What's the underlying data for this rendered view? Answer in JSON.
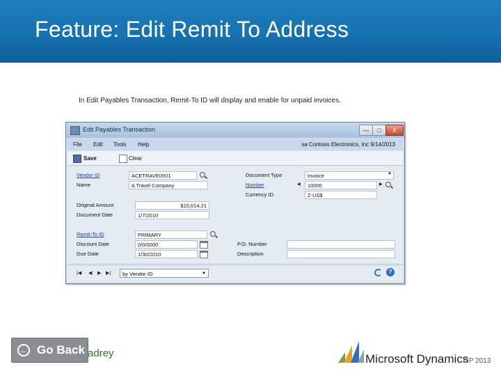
{
  "slide": {
    "title": "Feature: Edit Remit To Address",
    "caption": "In Edit Payables Transaction, Remit-To ID will display and enable for unpaid invoices."
  },
  "window": {
    "title": "Edit Payables Transaction",
    "buttons": {
      "minimize": "—",
      "maximize": "□",
      "close": "X"
    },
    "menu": [
      "File",
      "Edit",
      "Tools",
      "Help"
    ],
    "company": "sa  Contoso Electronics, Inc  9/14/2013",
    "toolbar": {
      "save": "Save",
      "clear": "Clear"
    },
    "fields": {
      "vendor_id": {
        "label": "Vendor ID",
        "value": "ACETRAVE0001"
      },
      "name": {
        "label": "Name",
        "value": "A Travel Company"
      },
      "original_amount": {
        "label": "Original Amount",
        "value": "$15,014.21"
      },
      "document_date": {
        "label": "Document Date",
        "value": "1/7/2010"
      },
      "remit_to_id": {
        "label": "Remit-To ID",
        "value": "PRIMARY"
      },
      "discount_date": {
        "label": "Discount Date",
        "value": "0/0/0000"
      },
      "due_date": {
        "label": "Due Date",
        "value": "1/30/2010"
      },
      "document_type": {
        "label": "Document Type",
        "value": "Invoice"
      },
      "number": {
        "label": "Number",
        "value": "10000"
      },
      "currency_id": {
        "label": "Currency ID",
        "value": "Z-US$"
      },
      "po_number": {
        "label": "P.O. Number",
        "value": ""
      },
      "description": {
        "label": "Description",
        "value": ""
      }
    },
    "navbar": {
      "sort_by": "by Vendor ID",
      "help": "?"
    }
  },
  "footer": {
    "go_back": "Go Back",
    "brand": "adrey",
    "ms_text": "Microsoft Dynamics",
    "gp": "GP 2013"
  },
  "colors": {
    "header_blue": "#1672b0",
    "link_blue": "#1a3f99",
    "brand_green": "#2f7a2f"
  }
}
